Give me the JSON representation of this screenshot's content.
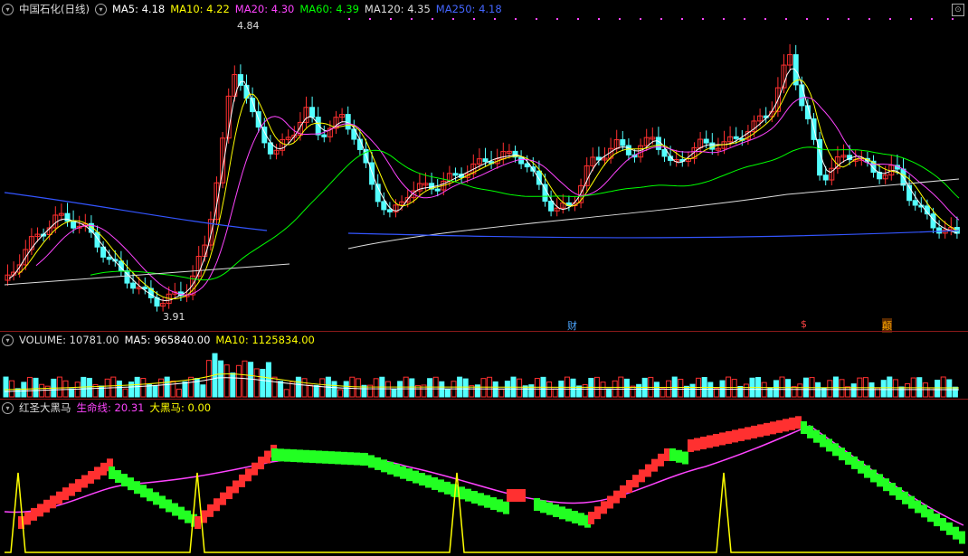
{
  "price": {
    "title": "中国石化(日线)",
    "indicators": [
      {
        "label": "MA5: 4.18",
        "color": "#ffffff"
      },
      {
        "label": "MA10: 4.22",
        "color": "#ffff00"
      },
      {
        "label": "MA20: 4.30",
        "color": "#ff44ff"
      },
      {
        "label": "MA60: 4.39",
        "color": "#00ff00"
      },
      {
        "label": "MA120: 4.35",
        "color": "#dddddd"
      },
      {
        "label": "MA250: 4.18",
        "color": "#4466ff"
      }
    ],
    "high_label": "4.84",
    "low_label": "3.91",
    "tags": [
      {
        "text": "财",
        "color": "#4da6ff"
      },
      {
        "text": "$",
        "color": "#ff4444"
      },
      {
        "text": "颠",
        "color": "#ffaa00"
      }
    ]
  },
  "volume": {
    "label": "VOLUME: 10781.00",
    "ma5": "MA5: 965840.00",
    "ma10": "MA10: 1125834.00"
  },
  "indicator": {
    "name": "红圣大黑马",
    "line1": "生命线: 20.31",
    "line2": "大黑马: 0.00"
  },
  "colors": {
    "up": "#ff3030",
    "down": "#54ffff",
    "bg": "#000000",
    "grid": "#8b1a1a"
  }
}
